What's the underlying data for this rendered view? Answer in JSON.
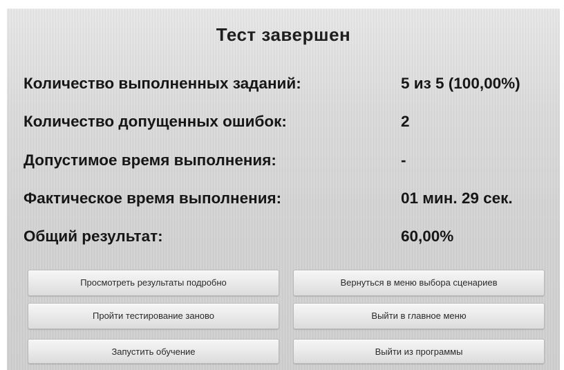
{
  "window": {
    "title": "Тест завершен"
  },
  "results": [
    {
      "label": "Количество выполненных заданий:",
      "value": "5 из 5 (100,00%)"
    },
    {
      "label": "Количество допущенных ошибок:",
      "value": "2"
    },
    {
      "label": "Допустимое время выполнения:",
      "value": "-"
    },
    {
      "label": "Фактическое время выполнения:",
      "value": "01 мин. 29 сек."
    },
    {
      "label": "Общий результат:",
      "value": "60,00%"
    }
  ],
  "buttons": {
    "view_details": "Просмотреть результаты подробно",
    "back_to_scenarios": "Вернуться в меню выбора сценариев",
    "retake_test": "Пройти тестирование заново",
    "main_menu": "Выйти в главное меню",
    "start_training": "Запустить обучение",
    "exit_program": "Выйти из программы"
  }
}
